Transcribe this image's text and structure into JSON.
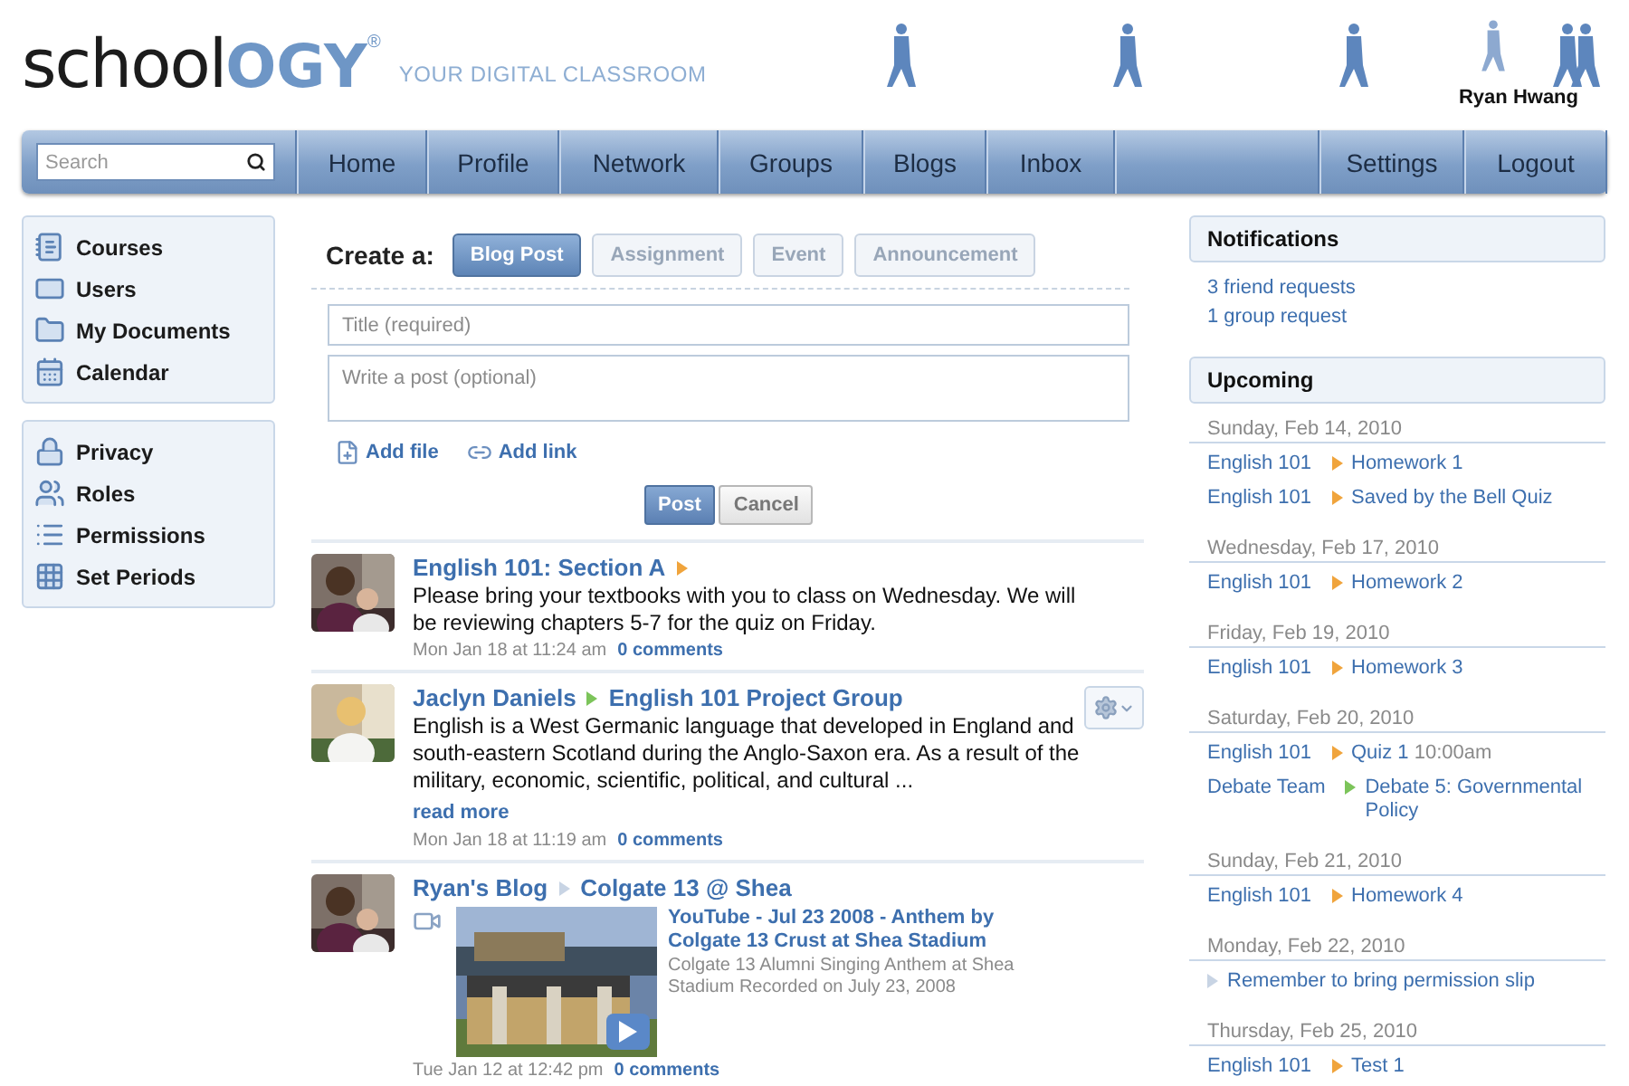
{
  "header": {
    "logo_dark": "school",
    "logo_light": "OGY",
    "logo_mark": "®",
    "tagline": "YOUR DIGITAL CLASSROOM",
    "user_name": "Ryan Hwang"
  },
  "nav": {
    "search": {
      "placeholder": "Search"
    },
    "items": [
      {
        "label": "Home"
      },
      {
        "label": "Profile"
      },
      {
        "label": "Network"
      },
      {
        "label": "Groups"
      },
      {
        "label": "Blogs"
      },
      {
        "label": "Inbox"
      }
    ],
    "right_items": [
      {
        "label": "Settings"
      },
      {
        "label": "Logout"
      }
    ]
  },
  "sidebar": {
    "groups": [
      {
        "items": [
          {
            "label": "Courses"
          },
          {
            "label": "Users"
          },
          {
            "label": "My Documents"
          },
          {
            "label": "Calendar"
          }
        ]
      },
      {
        "items": [
          {
            "label": "Privacy"
          },
          {
            "label": "Roles"
          },
          {
            "label": "Permissions"
          },
          {
            "label": "Set Periods"
          }
        ]
      }
    ]
  },
  "composer": {
    "label": "Create a:",
    "tabs": [
      {
        "label": "Blog Post",
        "selected": true
      },
      {
        "label": "Assignment",
        "selected": false
      },
      {
        "label": "Event",
        "selected": false
      },
      {
        "label": "Announcement",
        "selected": false
      }
    ],
    "title": {
      "placeholder": "Title (required)"
    },
    "body": {
      "placeholder": "Write a post (optional)"
    },
    "attachments": [
      {
        "label": "Add file"
      },
      {
        "label": "Add link"
      }
    ],
    "buttons": [
      {
        "label": "Post",
        "kind": "primary"
      },
      {
        "label": "Cancel",
        "kind": "secondary"
      }
    ]
  },
  "feed": [
    {
      "parts": [
        {
          "kind": "link",
          "text": "English 101: Section A"
        },
        {
          "kind": "arrow",
          "color": "#f0a43c"
        }
      ],
      "has_menu": false,
      "body": "Please bring your textbooks with you to class on Wednesday. We will be reviewing chapters 5-7 for the quiz on Friday.",
      "time": "Mon Jan 18 at 11:24 am",
      "comments": "0 comments"
    },
    {
      "parts": [
        {
          "kind": "link",
          "text": "Jaclyn Daniels"
        },
        {
          "kind": "arrow",
          "color": "#7cc45a"
        },
        {
          "kind": "link",
          "text": "English 101 Project Group"
        }
      ],
      "has_menu": true,
      "body": "English is a West Germanic language that developed in England and south-eastern Scotland during the Anglo-Saxon era. As a result of the military, economic, scientific, political, and cultural ...",
      "read_more": "read more",
      "time": "Mon Jan 18 at 11:19 am",
      "comments": "0 comments"
    },
    {
      "parts": [
        {
          "kind": "link",
          "text": "Ryan's Blog"
        },
        {
          "kind": "arrow",
          "color": "#c8d4e4"
        },
        {
          "kind": "link",
          "text": "Colgate 13 @ Shea"
        }
      ],
      "has_menu": false,
      "video": {
        "title": "YouTube - Jul 23 2008 - Anthem by Colgate 13 Crust at Shea Stadium",
        "description": "Colgate 13 Alumni Singing Anthem at Shea Stadium Recorded on July 23, 2008"
      },
      "time": "Tue Jan 12 at 12:42 pm",
      "comments": "0 comments"
    }
  ],
  "notifications": {
    "title": "Notifications",
    "items": [
      "3 friend requests",
      "1 group request"
    ]
  },
  "upcoming": {
    "title": "Upcoming",
    "days": [
      {
        "date": "Sunday, Feb 14, 2010",
        "events": [
          {
            "course": "English 101",
            "color": "#f0a43c",
            "title": "Homework 1"
          },
          {
            "course": "English 101",
            "color": "#f0a43c",
            "title": "Saved by the Bell Quiz"
          }
        ]
      },
      {
        "date": "Wednesday, Feb 17, 2010",
        "events": [
          {
            "course": "English 101",
            "color": "#f0a43c",
            "title": "Homework 2"
          }
        ]
      },
      {
        "date": "Friday, Feb 19, 2010",
        "events": [
          {
            "course": "English 101",
            "color": "#f0a43c",
            "title": "Homework 3"
          }
        ]
      },
      {
        "date": "Saturday, Feb 20, 2010",
        "events": [
          {
            "course": "English 101",
            "color": "#f0a43c",
            "title": "Quiz 1",
            "time": "10:00am"
          },
          {
            "course": "Debate Team",
            "color": "#7cc45a",
            "title": "Debate 5: Governmental Policy"
          }
        ]
      },
      {
        "date": "Sunday, Feb 21, 2010",
        "events": [
          {
            "course": "English 101",
            "color": "#f0a43c",
            "title": "Homework 4"
          }
        ]
      },
      {
        "date": "Monday, Feb 22, 2010",
        "events": [
          {
            "color": "#c8d4e4",
            "title": "Remember to bring permission slip"
          }
        ]
      },
      {
        "date": "Thursday, Feb 25, 2010",
        "events": [
          {
            "course": "English 101",
            "color": "#f0a43c",
            "title": "Test 1"
          }
        ]
      }
    ]
  }
}
